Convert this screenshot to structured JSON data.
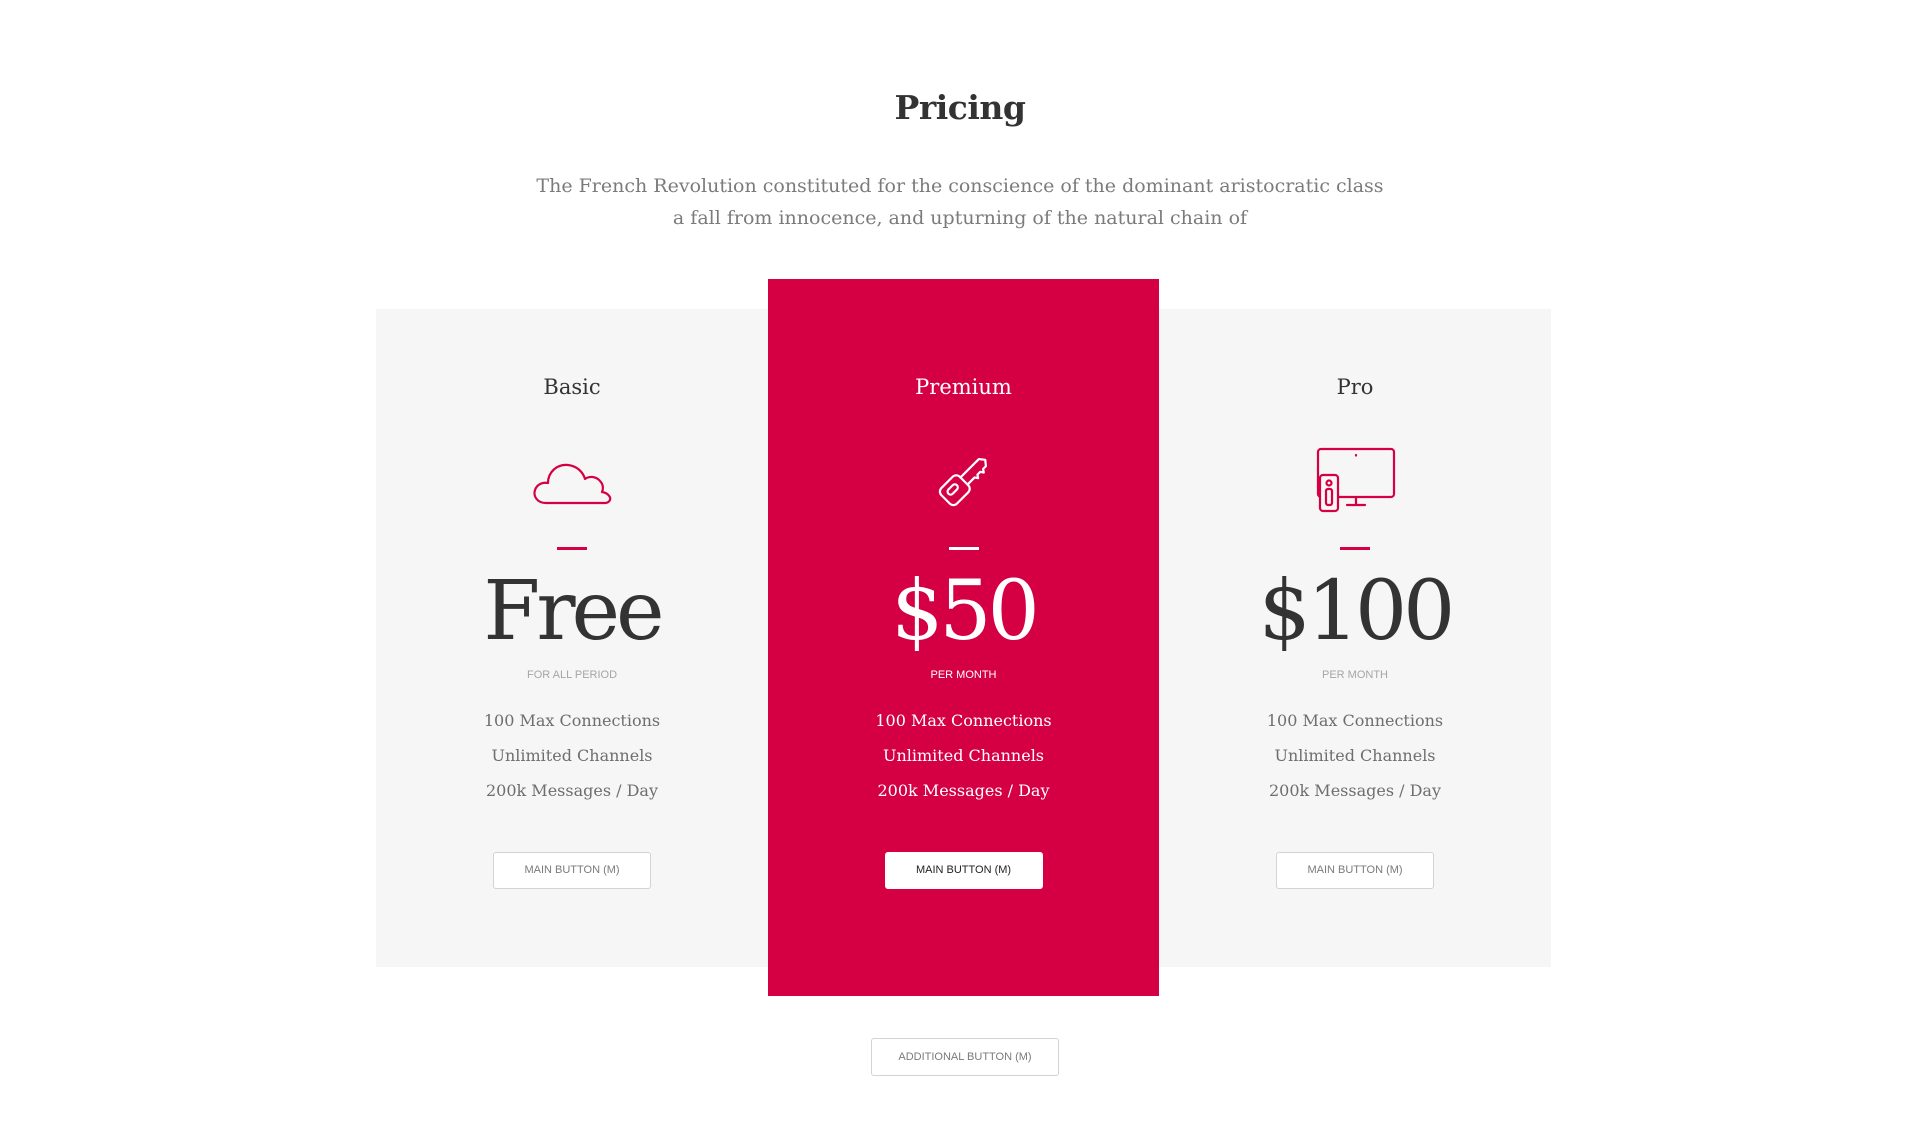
{
  "colors": {
    "accent": "#d50043",
    "card_background": "#f6f6f6",
    "heading": "#333333",
    "muted_text": "#7b7b7b"
  },
  "header": {
    "title": "Pricing",
    "subtitle_line1": "The French Revolution constituted for the conscience of the dominant aristocratic class",
    "subtitle_line2": "a fall from innocence, and upturning of the natural chain of"
  },
  "plans": [
    {
      "name": "Basic",
      "icon": "cloud-icon",
      "price": "Free",
      "period": "FOR ALL PERIOD",
      "features": [
        "100 Max Connections",
        "Unlimited Channels",
        "200k Messages / Day"
      ],
      "button_label": "MAIN BUTTON (M)",
      "highlighted": false
    },
    {
      "name": "Premium",
      "icon": "key-icon",
      "price": "$50",
      "period": "PER MONTH",
      "features": [
        "100 Max Connections",
        "Unlimited Channels",
        "200k Messages / Day"
      ],
      "button_label": "MAIN BUTTON (M)",
      "highlighted": true
    },
    {
      "name": "Pro",
      "icon": "devices-icon",
      "price": "$100",
      "period": "PER MONTH",
      "features": [
        "100 Max Connections",
        "Unlimited Channels",
        "200k Messages / Day"
      ],
      "button_label": "MAIN BUTTON (M)",
      "highlighted": false
    }
  ],
  "footer": {
    "additional_button_label": "ADDITIONAL BUTTON (M)"
  }
}
